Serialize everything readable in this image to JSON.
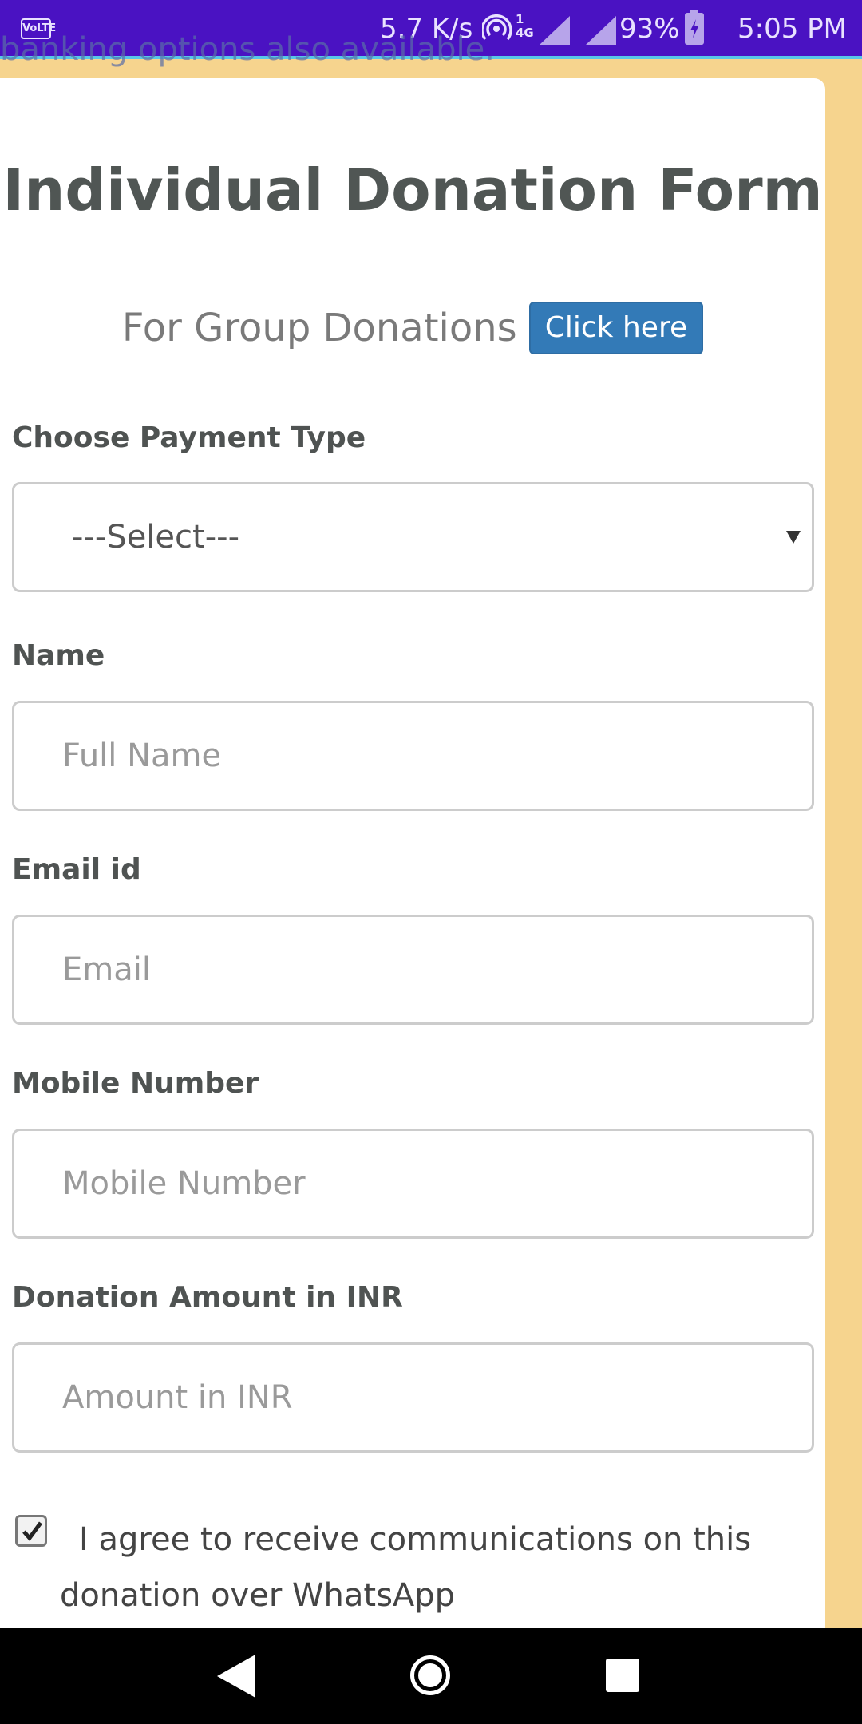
{
  "status_bar": {
    "volte": "VoLTE",
    "speed": "5.7 K/s",
    "network": "4G",
    "sim": "1",
    "battery": "93%",
    "time": "5:05 PM",
    "bg_color": "#4a12c2"
  },
  "bleed_text": "banking options also available.",
  "form": {
    "title": "Individual Donation Form",
    "group_text": "For Group Donations",
    "group_button": "Click here",
    "payment": {
      "label": "Choose Payment Type",
      "selected": "---Select---"
    },
    "name": {
      "label": "Name",
      "placeholder": "Full Name"
    },
    "email": {
      "label": "Email id",
      "placeholder": "Email"
    },
    "mobile": {
      "label": "Mobile Number",
      "placeholder": "Mobile Number"
    },
    "amount": {
      "label": "Donation Amount in INR",
      "placeholder": "Amount in INR"
    },
    "whatsapp_consent": {
      "checked": true,
      "text": "I agree to receive communications on this donation over WhatsApp"
    }
  },
  "colors": {
    "page_bg": "#f6d48e",
    "button": "#337ab7",
    "label": "#4f5352"
  },
  "icons": [
    "volte-icon",
    "hotspot-icon",
    "signal-icon",
    "battery-icon",
    "caret-down-icon",
    "check-icon",
    "back-icon",
    "home-icon",
    "recents-icon"
  ]
}
